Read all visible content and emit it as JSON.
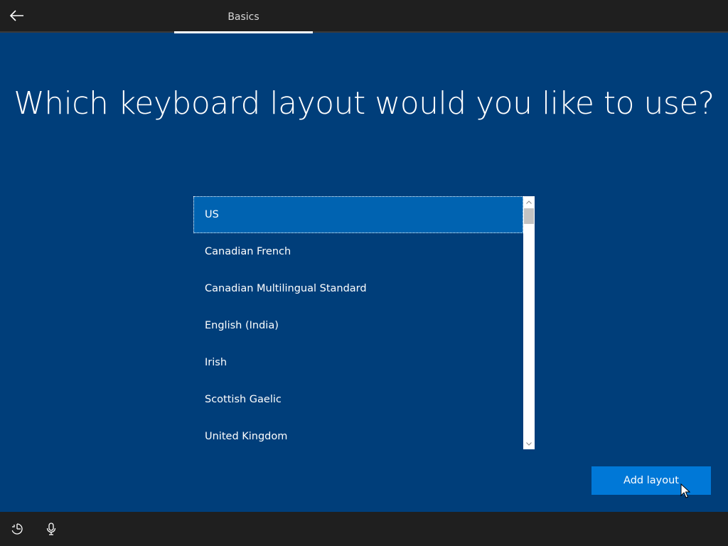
{
  "header": {
    "tab_label": "Basics"
  },
  "main": {
    "heading": "Which keyboard layout would you like to use?",
    "layouts": [
      "US",
      "Canadian French",
      "Canadian Multilingual Standard",
      "English (India)",
      "Irish",
      "Scottish Gaelic",
      "United Kingdom"
    ],
    "selected_layout": "US",
    "add_button_label": "Add layout"
  },
  "icons": {
    "back": "back-arrow-icon",
    "ease_of_access": "ease-of-access-icon",
    "microphone": "microphone-icon"
  },
  "colors": {
    "background": "#003e7a",
    "topbar": "#1f1f1f",
    "selected_item": "#0063b1",
    "button": "#0078d7"
  }
}
